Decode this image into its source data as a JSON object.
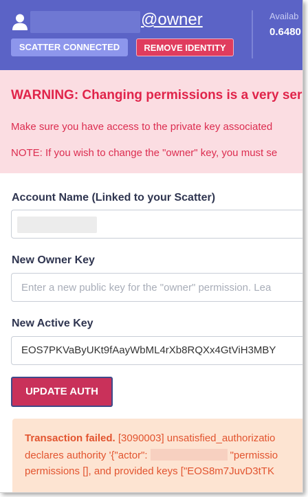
{
  "header": {
    "owner_suffix": "@owner",
    "scatter_badge": "SCATTER CONNECTED",
    "remove_identity": "REMOVE IDENTITY",
    "available_label": "Availab",
    "available_value": "0.6480"
  },
  "warning": {
    "title": "WARNING: Changing permissions is a very ser",
    "line1": "Make sure you have access to the private key associated",
    "line2": "NOTE: If you wish to change the \"owner\" key, you must se"
  },
  "form": {
    "account_label": "Account Name (Linked to your Scatter)",
    "owner_label": "New Owner Key",
    "owner_placeholder": "Enter a new public key for the \"owner\" permission. Lea",
    "active_label": "New Active Key",
    "active_value": "EOS7PKVaByUKt9fAayWbML4rXb8RQXx4GtViH3MBY",
    "update_button": "UPDATE AUTH"
  },
  "error": {
    "title": "Transaction failed.",
    "line1_rest": "[3090003] unsatisfied_authorizatio",
    "line2_a": "declares authority '{\"actor\":",
    "line2_b": "\"permissio",
    "line3": "permissions [], and provided keys [\"EOS8m7JuvD3tTK"
  },
  "colors": {
    "header_bg": "#5b63c6",
    "warning_bg": "#fbdde2",
    "warning_text": "#e0244a",
    "button_bg": "#c9315a",
    "error_bg": "#fde4d2",
    "error_text": "#e2542f"
  },
  "icons": {
    "user": "user-icon"
  }
}
